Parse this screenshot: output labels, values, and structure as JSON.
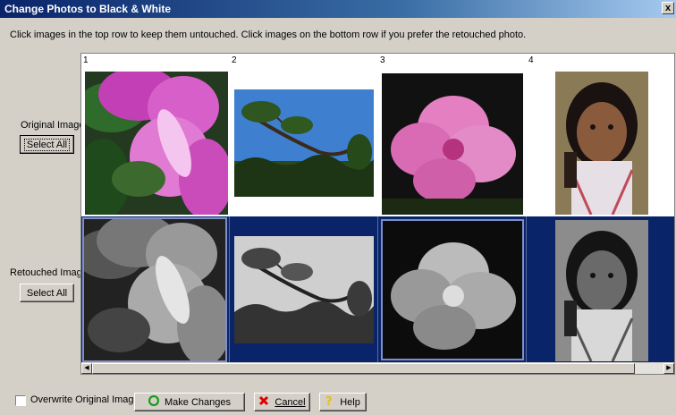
{
  "window": {
    "title": "Change Photos to Black & White",
    "close_label": "x"
  },
  "instructions": "Click images in the top row to keep them untouched.  Click images on the bottom row if you prefer the retouched photo.",
  "original": {
    "label": "Original Image:",
    "select_all": "Select All"
  },
  "retouched": {
    "label": "Retouched Image:",
    "select_all": "Select All"
  },
  "photos": [
    {
      "number": "1",
      "subject": "pink rhododendron flower"
    },
    {
      "number": "2",
      "subject": "pine tree against blue sky"
    },
    {
      "number": "3",
      "subject": "pink flower on dark background"
    },
    {
      "number": "4",
      "subject": "girl portrait"
    }
  ],
  "footer": {
    "overwrite_label": "Overwrite Original Image",
    "overwrite_checked": false,
    "make_changes": "Make Changes",
    "cancel": "Cancel",
    "help": "Help"
  },
  "colors": {
    "selection": "#0a246a",
    "titlebar": "#0a246a",
    "dialog": "#d4d0c8"
  }
}
